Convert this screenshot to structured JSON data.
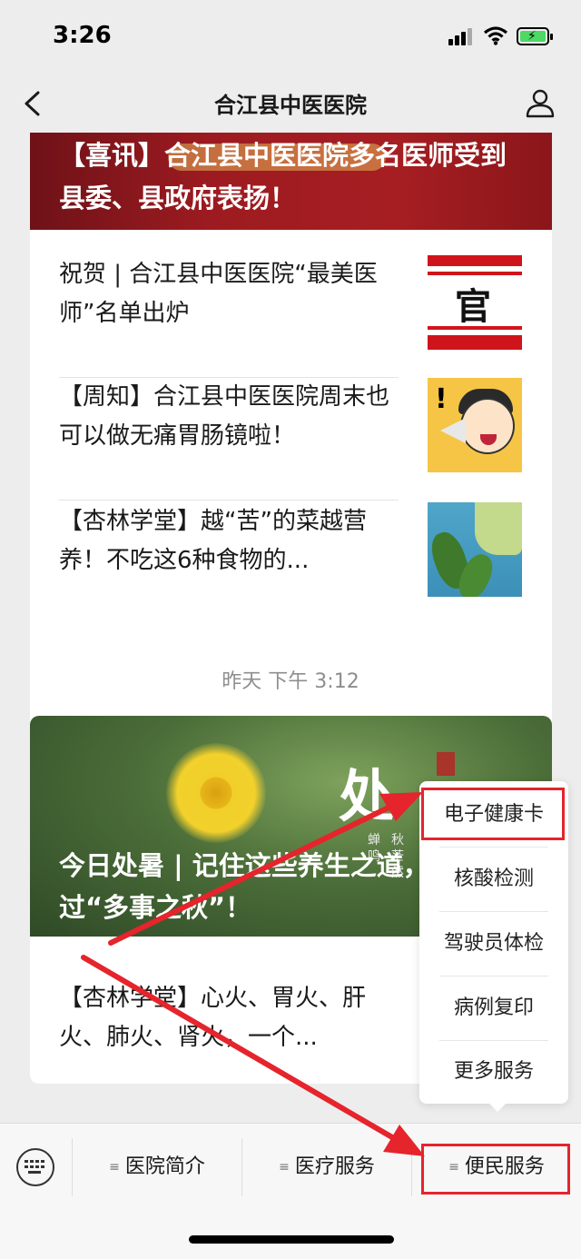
{
  "status_bar": {
    "time": "3:26"
  },
  "nav": {
    "title": "合江县中医医院"
  },
  "card1": {
    "banner_title": "【喜讯】合江县中医医院多名医师受到县委、县政府表扬！",
    "items": [
      {
        "title": "祝贺 | 合江县中医医院“最美医师”名单出炉",
        "thumb_text": "官 宣"
      },
      {
        "title": "【周知】合江县中医医院周末也可以做无痛胃肠镜啦！"
      },
      {
        "title": "【杏林学堂】越“苦”的菜越营养！不吃这6种食物的..."
      }
    ]
  },
  "timestamp": "昨天 下午 3:12",
  "card2": {
    "banner_title": "今日处暑 | 记住这些养生之道，安度过“多事之秋”！",
    "banner_glyph": "处",
    "banner_side_1": "蝉鸣",
    "banner_side_2": "秋茫然",
    "item_title": "【杏林学堂】心火、胃火、肝火、肺火、肾火，一个..."
  },
  "popup_menu": {
    "items": [
      "电子健康卡",
      "核酸检测",
      "驾驶员体检",
      "病例复印",
      "更多服务"
    ],
    "highlight_color": "#e5242c"
  },
  "bottom_menu": {
    "items": [
      "医院简介",
      "医疗服务",
      "便民服务"
    ],
    "ham_icon": "≡"
  },
  "colors": {
    "annotation_red": "#e5242c",
    "banner_red": "#a61e22"
  }
}
